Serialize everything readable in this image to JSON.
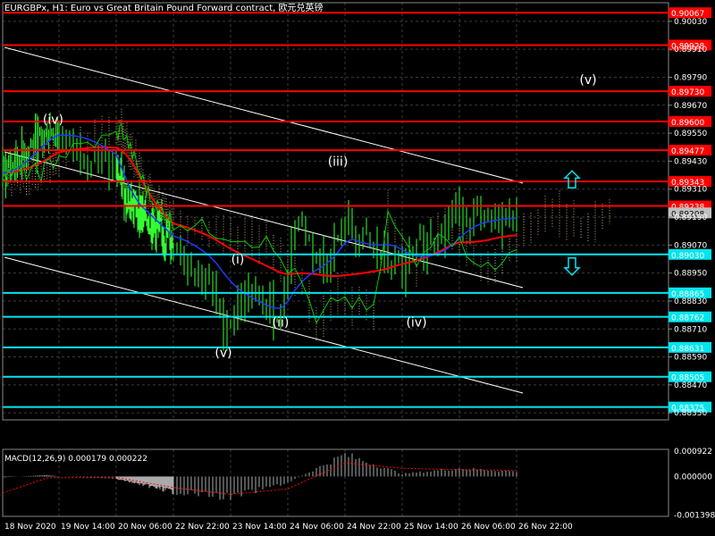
{
  "header": {
    "symbol_line": "EURGBPx, H1:  Euro vs Great Britain Pound Forward contract, 欧元兑英镑"
  },
  "colors": {
    "background": "#000000",
    "grid": "#3a3a3a",
    "candles": "#33ff33",
    "resistance": "#ff0000",
    "support": "#00e5ee",
    "channel": "#ffffff",
    "ma_red": "#ff0000",
    "ma_blue": "#1a3cff",
    "ichimoku_green": "#00cc00",
    "cloud_a": "#ffd5a0",
    "cloud_b": "#ffffff",
    "arrow": "#00e5ee",
    "macd_hist": "#c8c8c8",
    "macd_signal": "#ff0000",
    "text": "#ffffff",
    "axis_text": "#ffffff"
  },
  "chart_data": {
    "type": "candlestick",
    "title": "EURGBPx, H1:  Euro vs Great Britain Pound Forward contract, 欧元兑英镑",
    "y_axis": {
      "ticks": [
        "0.90030",
        "0.89910",
        "0.89790",
        "0.89670",
        "0.89550",
        "0.89430",
        "0.89310",
        "0.89190",
        "0.89070",
        "0.88950",
        "0.88830",
        "0.88710",
        "0.88590",
        "0.88470",
        "0.88350"
      ],
      "ylim": [
        0.8832,
        0.9011
      ]
    },
    "x_axis": {
      "ticks": [
        "18 Nov 2020",
        "19 Nov 14:00",
        "20 Nov 06:00",
        "22 Nov 22:00",
        "23 Nov 14:00",
        "24 Nov 06:00",
        "24 Nov 22:00",
        "25 Nov 14:00",
        "26 Nov 06:00",
        "26 Nov 22:00"
      ]
    },
    "resistance_levels": [
      {
        "label": "0.90067",
        "value": 0.90067
      },
      {
        "label": "0.89928",
        "value": 0.89928
      },
      {
        "label": "0.89730",
        "value": 0.8973
      },
      {
        "label": "0.89600",
        "value": 0.896
      },
      {
        "label": "0.89477",
        "value": 0.89477
      },
      {
        "label": "0.89343",
        "value": 0.89343
      },
      {
        "label": "0.89238",
        "value": 0.89238
      }
    ],
    "support_levels": [
      {
        "label": "0.89030",
        "value": 0.8903
      },
      {
        "label": "0.88865",
        "value": 0.88865
      },
      {
        "label": "0.88762",
        "value": 0.88762
      },
      {
        "label": "0.88631",
        "value": 0.88631
      },
      {
        "label": "0.88505",
        "value": 0.88505
      },
      {
        "label": "0.88375",
        "value": 0.88375
      }
    ],
    "current_price": {
      "label": "0.89208",
      "value": 0.89208
    },
    "wave_labels": [
      {
        "text": "(iv)",
        "x": "19 Nov 10:00",
        "value": 0.8961
      },
      {
        "text": "(v)",
        "x": "23 Nov 12:00",
        "value": 0.8861
      },
      {
        "text": "(i)",
        "x": "23 Nov 16:00",
        "value": 0.8901
      },
      {
        "text": "(ii)",
        "x": "24 Nov 04:00",
        "value": 0.8874
      },
      {
        "text": "(iii)",
        "x": "24 Nov 20:00",
        "value": 0.8943
      },
      {
        "text": "(iv)",
        "x": "25 Nov 18:00",
        "value": 0.8874
      },
      {
        "text": "(v)",
        "x": "27 Nov 18:00",
        "value": 0.8978
      }
    ],
    "price_path": {
      "x": [
        "18 Nov 00:00",
        "18 Nov 20:00",
        "19 Nov 10:00",
        "19 Nov 18:00",
        "20 Nov 06:00",
        "20 Nov 20:00",
        "22 Nov 22:00",
        "23 Nov 08:00",
        "23 Nov 12:00",
        "23 Nov 18:00",
        "24 Nov 04:00",
        "24 Nov 08:00",
        "24 Nov 16:00",
        "24 Nov 22:00",
        "25 Nov 06:00",
        "25 Nov 14:00",
        "25 Nov 20:00",
        "26 Nov 06:00",
        "26 Nov 14:00",
        "26 Nov 22:00"
      ],
      "values": [
        0.8938,
        0.895,
        0.8957,
        0.895,
        0.8938,
        0.8926,
        0.8908,
        0.889,
        0.8872,
        0.8885,
        0.8878,
        0.892,
        0.8898,
        0.8915,
        0.8905,
        0.8895,
        0.8908,
        0.8922,
        0.8915,
        0.8921
      ]
    },
    "indicator": {
      "name": "MACD(12,26,9) 0.000179 0.000222",
      "ticks": [
        "0.000922",
        "0.000000",
        "-0.001398"
      ],
      "ylim": [
        -0.00145,
        0.00099
      ],
      "x": [
        "18 Nov 00:00",
        "19 Nov 06:00",
        "20 Nov 06:00",
        "22 Nov 22:00",
        "23 Nov 14:00",
        "24 Nov 06:00",
        "24 Nov 22:00",
        "25 Nov 14:00",
        "26 Nov 06:00",
        "26 Nov 22:00"
      ],
      "histogram": [
        -3e-05,
        5e-05,
        -8e-05,
        -0.00055,
        -0.00075,
        -0.00022,
        0.0008,
        0.0001,
        0.0003,
        0.00018
      ],
      "signal": [
        -0.0006,
        -5e-05,
        -3e-05,
        -0.0004,
        -0.00065,
        -0.00045,
        0.0005,
        0.0003,
        0.00025,
        0.00022
      ]
    }
  }
}
